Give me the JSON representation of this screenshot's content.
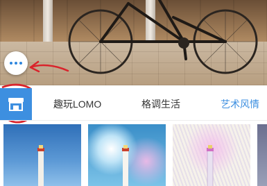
{
  "photo": {
    "subject": "bicycle"
  },
  "more_button": {
    "icon": "more-dots-icon",
    "accent": "#2e86de"
  },
  "annotation": {
    "color": "#d9232b"
  },
  "tabs": {
    "store_icon": "store-icon",
    "items": [
      {
        "label": "趣玩LOMO",
        "active": false
      },
      {
        "label": "格调生活",
        "active": false
      },
      {
        "label": "艺术风情",
        "active": true
      }
    ],
    "accent": "#3d8fe0"
  },
  "thumbnails": [
    {
      "name": "lighthouse-blue"
    },
    {
      "name": "lighthouse-watercolor"
    },
    {
      "name": "lighthouse-sketch"
    },
    {
      "name": "lighthouse-partial"
    }
  ]
}
